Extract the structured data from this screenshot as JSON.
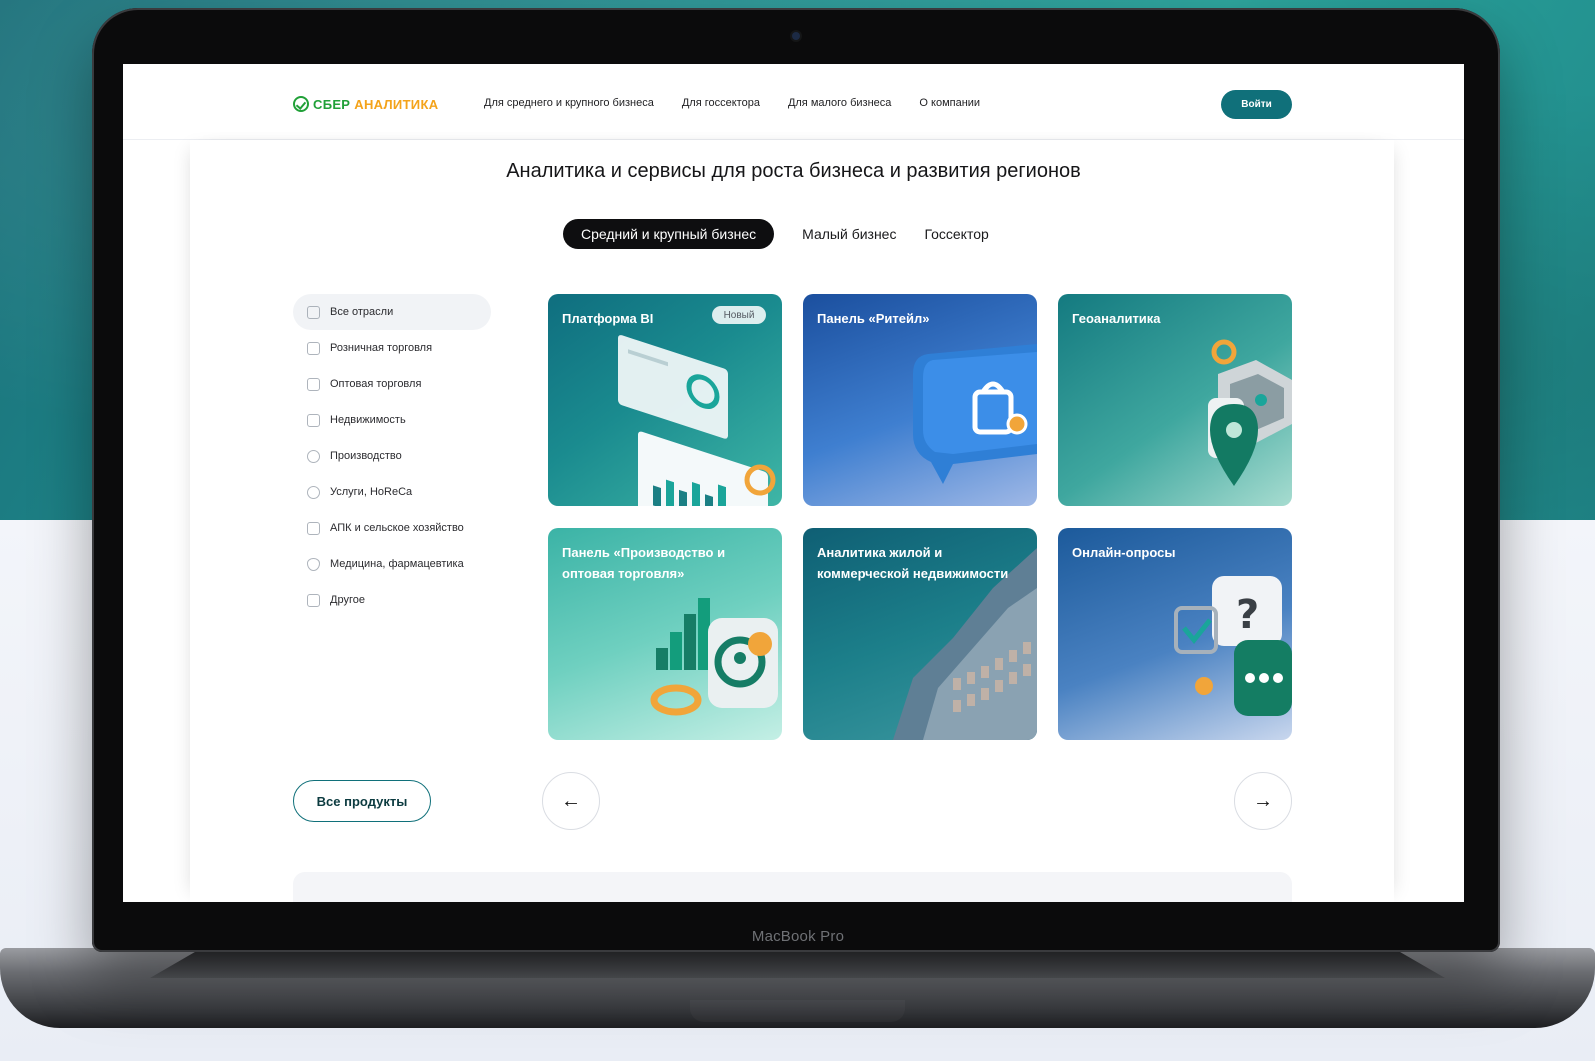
{
  "device": {
    "label": "MacBook Pro"
  },
  "header": {
    "logo": {
      "part1": "СБЕР",
      "part2": "АНАЛИТИКА"
    },
    "nav": [
      "Для среднего и крупного бизнеса",
      "Для госсектора",
      "Для малого бизнеса",
      "О компании"
    ],
    "login_label": "Войти"
  },
  "main": {
    "headline": "Аналитика и сервисы для роста бизнеса и развития регионов",
    "segments": [
      "Средний и крупный бизнес",
      "Малый бизнес",
      "Госсектор"
    ],
    "active_segment": "Средний и крупный бизнес"
  },
  "sidebar": {
    "items": [
      {
        "label": "Все отрасли",
        "icon": "list-icon",
        "active": true
      },
      {
        "label": "Розничная торговля",
        "icon": "cart-icon"
      },
      {
        "label": "Оптовая торговля",
        "icon": "trolley-icon"
      },
      {
        "label": "Недвижимость",
        "icon": "building-icon"
      },
      {
        "label": "Производство",
        "icon": "bulb-icon"
      },
      {
        "label": "Услуги, HoReCa",
        "icon": "people-icon"
      },
      {
        "label": "АПК и сельское хозяйство",
        "icon": "tractor-icon"
      },
      {
        "label": "Медицина, фармацевтика",
        "icon": "heart-shield-icon"
      },
      {
        "label": "Другое",
        "icon": "plus-box-icon"
      }
    ]
  },
  "cards": [
    {
      "title": "Платформа BI",
      "badge": "Новый"
    },
    {
      "title": "Панель «Ритейл»"
    },
    {
      "title": "Геоаналитика"
    },
    {
      "title": "Панель «Производство и оптовая торговля»"
    },
    {
      "title": "Аналитика жилой и коммерческой недвижимости"
    },
    {
      "title": "Онлайн-опросы"
    }
  ],
  "controls": {
    "all_products": "Все продукты",
    "prev_icon": "←",
    "next_icon": "→"
  },
  "colors": {
    "brand_green": "#21a038",
    "brand_orange": "#f4a31a",
    "accent_teal": "#10707a"
  }
}
